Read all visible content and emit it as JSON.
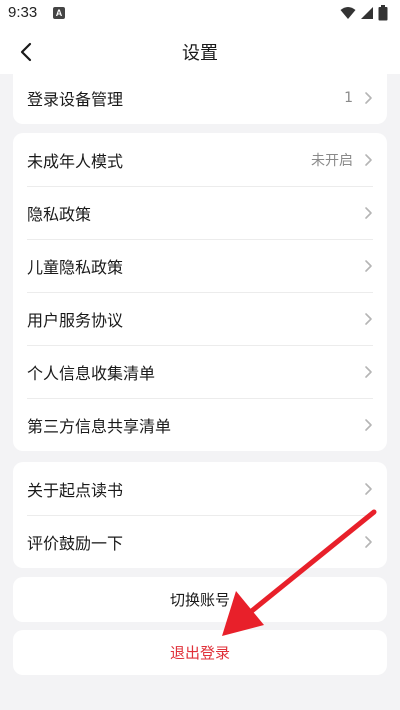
{
  "status_bar": {
    "time": "9:33",
    "notification_icon": "A"
  },
  "header": {
    "title": "设置",
    "back_icon": "chevron-left-icon"
  },
  "device_section": {
    "label": "登录设备管理",
    "value": "1"
  },
  "group1": [
    {
      "label": "未成年人模式",
      "value": "未开启"
    },
    {
      "label": "隐私政策",
      "value": ""
    },
    {
      "label": "儿童隐私政策",
      "value": ""
    },
    {
      "label": "用户服务协议",
      "value": ""
    },
    {
      "label": "个人信息收集清单",
      "value": ""
    },
    {
      "label": "第三方信息共享清单",
      "value": ""
    }
  ],
  "group2": [
    {
      "label": "关于起点读书",
      "value": ""
    },
    {
      "label": "评价鼓励一下",
      "value": ""
    }
  ],
  "switch_account": {
    "label": "切换账号"
  },
  "logout": {
    "label": "退出登录",
    "color": "#e0313a"
  },
  "annotation": {
    "color": "#e8202a"
  },
  "colors": {
    "background": "#f3f3f5",
    "card": "#ffffff",
    "secondary_text": "#8a8a8a"
  }
}
